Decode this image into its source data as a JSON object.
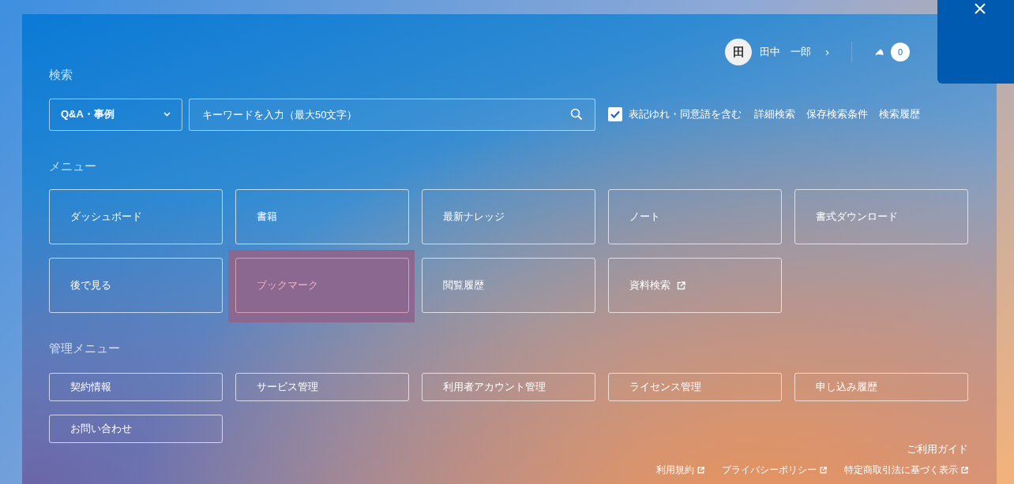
{
  "user": {
    "initial": "田",
    "name": "田中　一郎",
    "chevron": "›"
  },
  "notifications": {
    "count": "0"
  },
  "search": {
    "label": "検索",
    "category": "Q&A・事例",
    "placeholder": "キーワードを入力（最大50文字）",
    "synonyms": {
      "label": "表記ゆれ・同意語を含む",
      "checked": true
    },
    "links": [
      "詳細検索",
      "保存検索条件",
      "検索履歴"
    ]
  },
  "menu": {
    "title": "メニュー",
    "items": [
      {
        "label": "ダッシュボード",
        "external": false,
        "selected": false
      },
      {
        "label": "書籍",
        "external": false,
        "selected": false
      },
      {
        "label": "最新ナレッジ",
        "external": false,
        "selected": false
      },
      {
        "label": "ノート",
        "external": false,
        "selected": false
      },
      {
        "label": "書式ダウンロード",
        "external": false,
        "selected": false
      },
      {
        "label": "後で見る",
        "external": false,
        "selected": false
      },
      {
        "label": "ブックマーク",
        "external": false,
        "selected": true
      },
      {
        "label": "閲覧履歴",
        "external": false,
        "selected": false
      },
      {
        "label": "資料検索",
        "external": true,
        "selected": false
      }
    ]
  },
  "admin_menu": {
    "title": "管理メニュー",
    "items": [
      "契約情報",
      "サービス管理",
      "利用者アカウント管理",
      "ライセンス管理",
      "申し込み履歴",
      "お問い合わせ"
    ]
  },
  "footer": {
    "guide": "ご利用ガイド",
    "links": [
      "利用規約",
      "プライバシーポリシー",
      "特定商取引法に基づく表示"
    ]
  }
}
